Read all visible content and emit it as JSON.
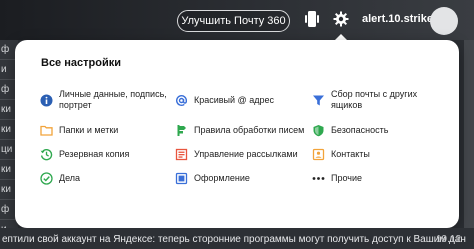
{
  "header": {
    "upgrade_label": "Улучшить Почту 360",
    "username": "alert.10.strike"
  },
  "background": {
    "left_rows": [
      "ф",
      "и",
      "ф",
      "ки",
      "ки",
      "ци",
      "ки",
      "ки",
      "ф",
      "и"
    ],
    "bottom_message": "ептили свой аккаунт на Яндексе: теперь сторонние программы могут получить доступ к Вашим дан",
    "bottom_date": "19.12"
  },
  "settings": {
    "title": "Все настройки",
    "items": [
      {
        "label": "Личные данные, подпись, портрет",
        "icon": "info-icon",
        "color": "#2b5fb3"
      },
      {
        "label": "Красивый @ адрес",
        "icon": "at-icon",
        "color": "#3a6fd8"
      },
      {
        "label": "Сбор почты с других ящиков",
        "icon": "funnel-icon",
        "color": "#3a6fd8"
      },
      {
        "label": "Папки и метки",
        "icon": "folder-icon",
        "color": "#f2a33a"
      },
      {
        "label": "Правила обработки писем",
        "icon": "rules-icon",
        "color": "#2fa84f"
      },
      {
        "label": "Безопасность",
        "icon": "shield-icon",
        "color": "#2fa84f"
      },
      {
        "label": "Резервная копия",
        "icon": "history-icon",
        "color": "#2fa84f"
      },
      {
        "label": "Управление рассылками",
        "icon": "newsletter-icon",
        "color": "#e8553e"
      },
      {
        "label": "Контакты",
        "icon": "contacts-icon",
        "color": "#f2a33a"
      },
      {
        "label": "Дела",
        "icon": "check-icon",
        "color": "#2fa84f"
      },
      {
        "label": "Оформление",
        "icon": "theme-icon",
        "color": "#3a6fd8"
      },
      {
        "label": "Прочие",
        "icon": "more-icon",
        "color": "#222222"
      }
    ]
  }
}
